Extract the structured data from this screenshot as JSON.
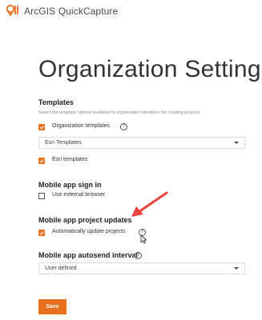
{
  "app": {
    "title": "ArcGIS QuickCapture",
    "logo_icon": "map-pin-logo-icon",
    "brand_color": "#e8701f"
  },
  "page": {
    "title": "Organization Settings"
  },
  "templates": {
    "heading": "Templates",
    "description": "Select the template options available to organization members for creating projects.",
    "org_templates": {
      "label": "Organization templates",
      "checked": true
    },
    "templates_select": {
      "value": "Esri Templates"
    },
    "esri_templates": {
      "label": "Esri templates",
      "checked": true
    }
  },
  "sign_in": {
    "heading": "Mobile app sign in",
    "external_browser": {
      "label": "Use external browser",
      "checked": false
    }
  },
  "project_updates": {
    "heading": "Mobile app project updates",
    "auto_update": {
      "label": "Automatically update projects",
      "checked": true
    }
  },
  "autosend": {
    "heading": "Mobile app autosend interval",
    "select": {
      "value": "User defined"
    }
  },
  "help_icon_text": "?",
  "actions": {
    "save_label": "Save"
  },
  "annotation": {
    "arrow_color": "#e8453c"
  }
}
